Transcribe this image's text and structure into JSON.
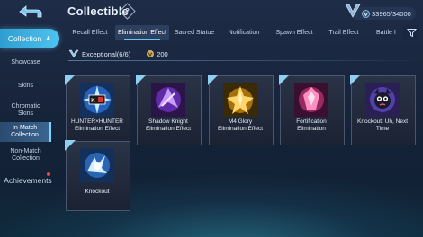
{
  "header": {
    "title": "Collectible",
    "help_label": "?",
    "currency": "33965/34000"
  },
  "sidebar": {
    "section": "Collection",
    "items": [
      {
        "label": "Showcase"
      },
      {
        "label": "Skins"
      },
      {
        "label": "Chromatic Skins"
      },
      {
        "label": "In-Match Collection"
      },
      {
        "label": "Non-Match Collection"
      }
    ],
    "achievements": "Achievements"
  },
  "tabs": [
    {
      "label": "Recall Effect"
    },
    {
      "label": "Elimination Effect"
    },
    {
      "label": "Sacred Statue"
    },
    {
      "label": "Notification"
    },
    {
      "label": "Spawn Effect"
    },
    {
      "label": "Trail Effect"
    },
    {
      "label": "Battle I"
    }
  ],
  "group": {
    "name": "Exceptional(6/6)",
    "points": "200"
  },
  "cards": [
    {
      "name": "HUNTER×HUNTER Elimination Effect",
      "line1": "HUNTER×HUNTER",
      "line2": "Elimination Effect"
    },
    {
      "name": "Shadow Knight Elimination Effect",
      "line1": "Shadow Knight",
      "line2": "Elimination Effect"
    },
    {
      "name": "M4 Glory Elimination Effect",
      "line1": "M4 Glory",
      "line2": "Elimination Effect"
    },
    {
      "name": "Fortification Elimination",
      "line1": "Fortification",
      "line2": "Elimination"
    },
    {
      "name": "Knockout: Uh, Next Time",
      "line1": "Knockout: Uh, Next",
      "line2": "Time"
    },
    {
      "name": "Knockout",
      "line1": "Knockout",
      "line2": ""
    }
  ],
  "colors": {
    "accent": "#4fc3ef",
    "background": "#1b2740"
  }
}
